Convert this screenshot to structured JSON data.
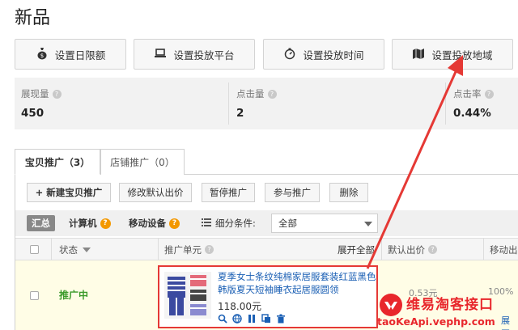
{
  "page": {
    "title": "新品"
  },
  "top_buttons": [
    {
      "label": "设置日限额",
      "icon": "moneybag-icon"
    },
    {
      "label": "设置投放平台",
      "icon": "laptop-icon"
    },
    {
      "label": "设置投放时间",
      "icon": "stopwatch-icon"
    },
    {
      "label": "设置投放地域",
      "icon": "map-icon"
    }
  ],
  "stats": [
    {
      "label": "展现量",
      "value": "450"
    },
    {
      "label": "点击量",
      "value": "2"
    },
    {
      "label": "点击率",
      "value": "0.44%"
    }
  ],
  "tabs": [
    {
      "label": "宝贝推广（3）",
      "active": true
    },
    {
      "label": "店铺推广（0）",
      "active": false
    }
  ],
  "actions": {
    "new": "+ 新建宝贝推广",
    "edit_bid": "修改默认出价",
    "pause": "暂停推广",
    "resume": "参与推广",
    "delete": "删除"
  },
  "filter": {
    "summary": "汇总",
    "computer": "计算机",
    "mobile": "移动设备",
    "condition_label": "细分条件:",
    "condition_value": "全部"
  },
  "table": {
    "headers": {
      "status": "状态",
      "unit": "推广单元",
      "expand_all": "展开全部",
      "default_bid": "默认出价",
      "mobile_bid": "移动出"
    },
    "row": {
      "status": "推广中",
      "product_title": "夏季女士条纹纯棉家居服套装红蓝黑色韩版夏天短袖睡衣起居服圆领",
      "price": "118.00元",
      "expand": "展开",
      "default_bid": "0.53元",
      "mobile_bid": "100%"
    }
  },
  "watermark": {
    "name": "维易淘客接口",
    "url": "taoKeApi.vephp.com"
  },
  "colors": {
    "highlight": "#e53935",
    "active_status": "#3a9a2a",
    "link": "#1a5fb4",
    "warn": "#f39800"
  }
}
